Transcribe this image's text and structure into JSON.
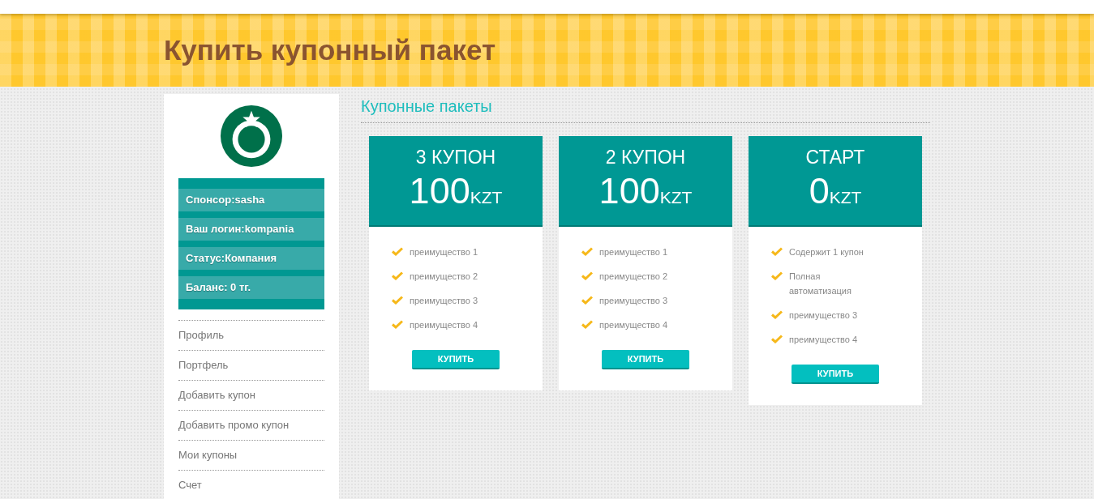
{
  "page_title": "Купить купонный пакет",
  "sidebar": {
    "info": [
      "Спонсор:sasha",
      "Ваш логин:kompania",
      "Статус:Компания",
      "Баланс: 0 тг."
    ],
    "menu": [
      "Профиль",
      "Портфель",
      "Добавить купон",
      "Добавить промо купон",
      "Мои купоны",
      "Счет"
    ]
  },
  "section_title": "Купонные пакеты",
  "packages": [
    {
      "name": "3 КУПОН",
      "price": "100",
      "currency": "KZT",
      "features": [
        "преимущество 1",
        "преимущество 2",
        "преимущество 3",
        "преимущество 4"
      ],
      "button": "КУПИТЬ"
    },
    {
      "name": "2 КУПОН",
      "price": "100",
      "currency": "KZT",
      "features": [
        "преимущество 1",
        "преимущество 2",
        "преимущество 3",
        "преимущество 4"
      ],
      "button": "КУПИТЬ"
    },
    {
      "name": "СТАРТ",
      "price": "0",
      "currency": "KZT",
      "features": [
        "Содержит 1 купон",
        "Полная автоматизация",
        "преимущество 3",
        "преимущество 4"
      ],
      "button": "КУПИТЬ"
    }
  ]
}
